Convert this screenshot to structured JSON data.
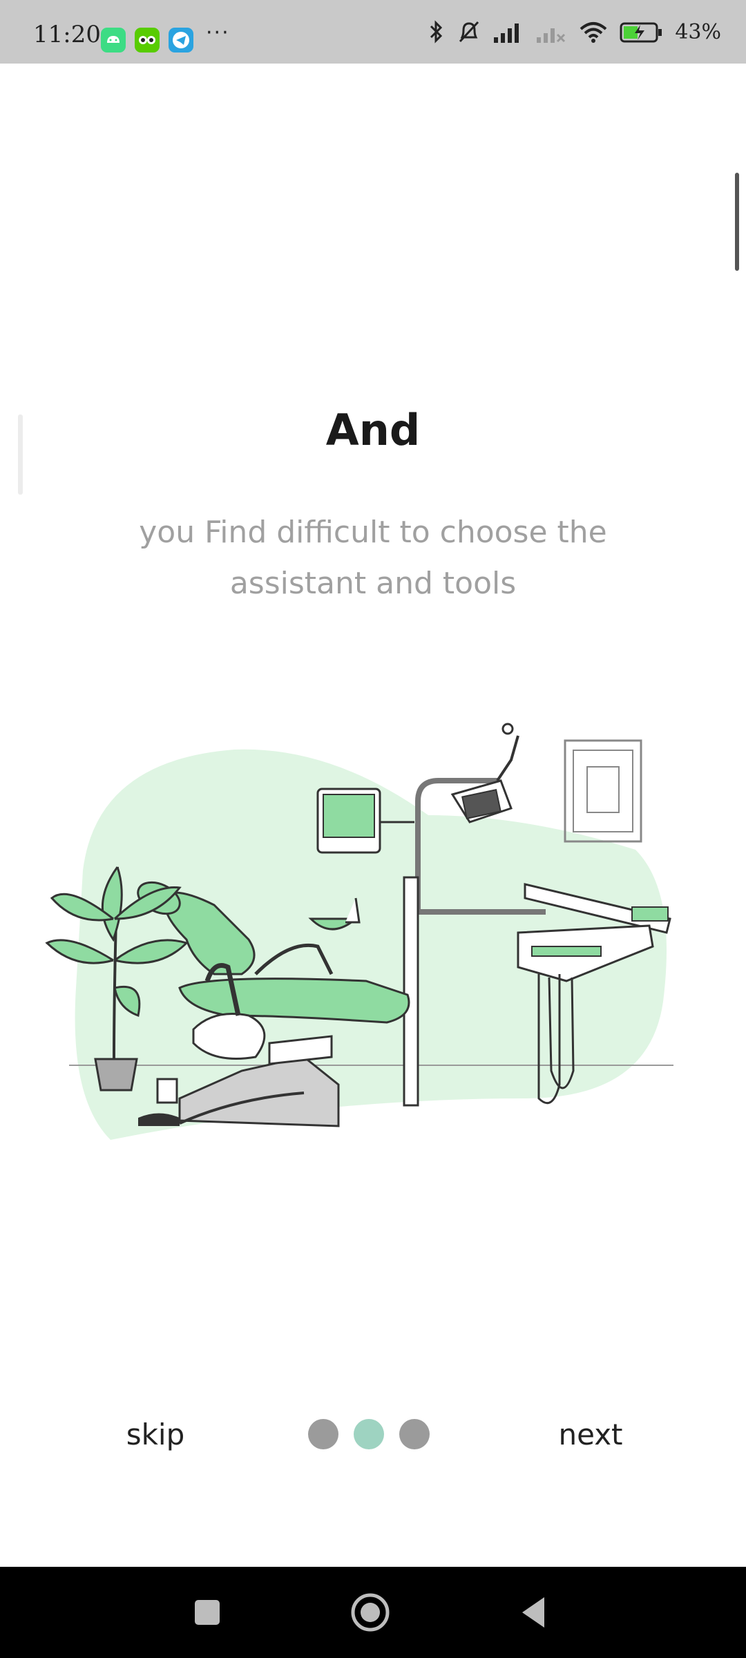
{
  "status_bar": {
    "time": "11:20",
    "battery_text": "43%",
    "icons": [
      "android-icon",
      "duolingo-icon",
      "telegram-icon",
      "more-icon",
      "bluetooth-icon",
      "mute-icon",
      "signal-icon",
      "signal-off-icon",
      "wifi-icon",
      "battery-charging-icon"
    ]
  },
  "onboarding": {
    "title": "And",
    "subtitle": "you Find difficult to choose the assistant and tools",
    "illustration": "dental-chair-illustration"
  },
  "footer": {
    "skip_label": "skip",
    "next_label": "next",
    "page_count": 3,
    "active_page": 2
  },
  "colors": {
    "accent": "#9ed3c1",
    "illustration_green": "#8fdba1",
    "blob": "#dff5e3",
    "dot_inactive": "#9b9b9b"
  },
  "nav_bar": {
    "buttons": [
      "recents-icon",
      "home-icon",
      "back-icon"
    ]
  }
}
